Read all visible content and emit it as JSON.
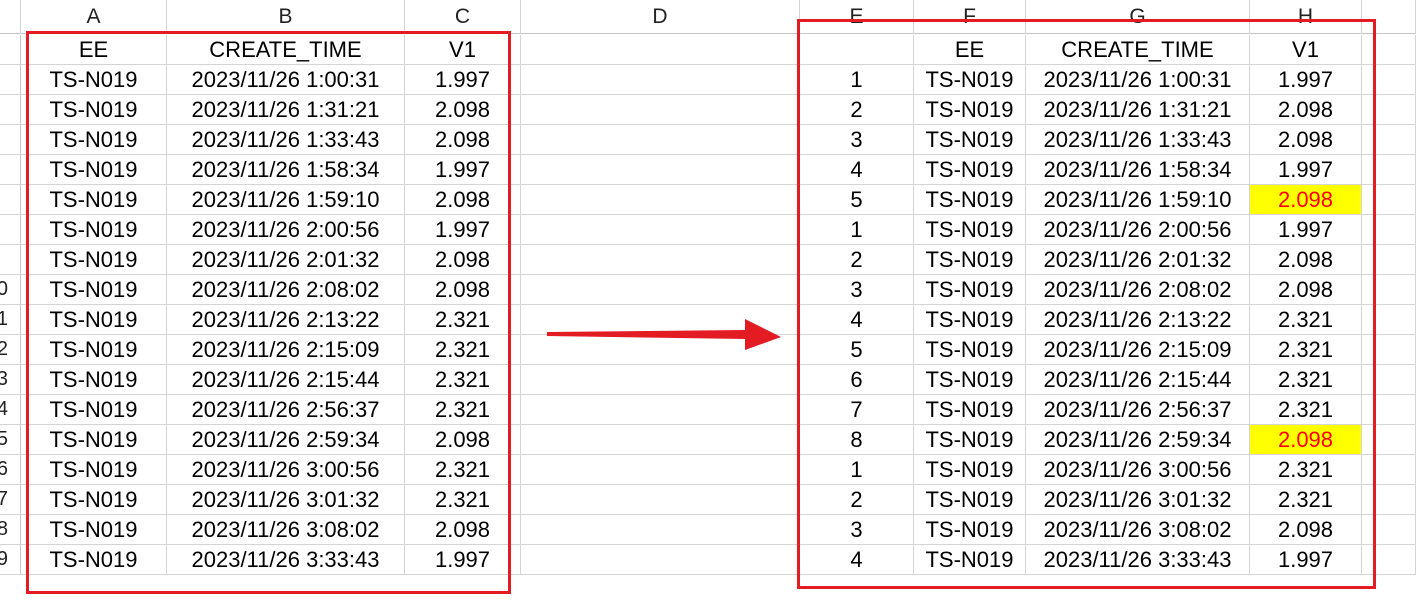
{
  "accent_color": "#e31b23",
  "highlight_fill": "#ffff00",
  "highlight_text": "#ff0000",
  "columns": [
    "A",
    "B",
    "C",
    "D",
    "E",
    "F",
    "G",
    "H"
  ],
  "row_numbers": [
    "",
    "",
    "",
    "",
    "",
    "",
    "",
    "",
    "0",
    "1",
    "2",
    "3",
    "4",
    "5",
    "6",
    "7",
    "8",
    "9"
  ],
  "left_table": {
    "headers": [
      "EE",
      "CREATE_TIME",
      "V1"
    ],
    "rows": [
      [
        "TS-N019",
        "2023/11/26 1:00:31",
        "1.997"
      ],
      [
        "TS-N019",
        "2023/11/26 1:31:21",
        "2.098"
      ],
      [
        "TS-N019",
        "2023/11/26 1:33:43",
        "2.098"
      ],
      [
        "TS-N019",
        "2023/11/26 1:58:34",
        "1.997"
      ],
      [
        "TS-N019",
        "2023/11/26 1:59:10",
        "2.098"
      ],
      [
        "TS-N019",
        "2023/11/26 2:00:56",
        "1.997"
      ],
      [
        "TS-N019",
        "2023/11/26 2:01:32",
        "2.098"
      ],
      [
        "TS-N019",
        "2023/11/26 2:08:02",
        "2.098"
      ],
      [
        "TS-N019",
        "2023/11/26 2:13:22",
        "2.321"
      ],
      [
        "TS-N019",
        "2023/11/26 2:15:09",
        "2.321"
      ],
      [
        "TS-N019",
        "2023/11/26 2:15:44",
        "2.321"
      ],
      [
        "TS-N019",
        "2023/11/26 2:56:37",
        "2.321"
      ],
      [
        "TS-N019",
        "2023/11/26 2:59:34",
        "2.098"
      ],
      [
        "TS-N019",
        "2023/11/26 3:00:56",
        "2.321"
      ],
      [
        "TS-N019",
        "2023/11/26 3:01:32",
        "2.321"
      ],
      [
        "TS-N019",
        "2023/11/26 3:08:02",
        "2.098"
      ],
      [
        "TS-N019",
        "2023/11/26 3:33:43",
        "1.997"
      ]
    ]
  },
  "right_table": {
    "headers": [
      "",
      "EE",
      "CREATE_TIME",
      "V1"
    ],
    "rows": [
      [
        "1",
        "TS-N019",
        "2023/11/26 1:00:31",
        "1.997"
      ],
      [
        "2",
        "TS-N019",
        "2023/11/26 1:31:21",
        "2.098"
      ],
      [
        "3",
        "TS-N019",
        "2023/11/26 1:33:43",
        "2.098"
      ],
      [
        "4",
        "TS-N019",
        "2023/11/26 1:58:34",
        "1.997"
      ],
      [
        "5",
        "TS-N019",
        "2023/11/26 1:59:10",
        "2.098"
      ],
      [
        "1",
        "TS-N019",
        "2023/11/26 2:00:56",
        "1.997"
      ],
      [
        "2",
        "TS-N019",
        "2023/11/26 2:01:32",
        "2.098"
      ],
      [
        "3",
        "TS-N019",
        "2023/11/26 2:08:02",
        "2.098"
      ],
      [
        "4",
        "TS-N019",
        "2023/11/26 2:13:22",
        "2.321"
      ],
      [
        "5",
        "TS-N019",
        "2023/11/26 2:15:09",
        "2.321"
      ],
      [
        "6",
        "TS-N019",
        "2023/11/26 2:15:44",
        "2.321"
      ],
      [
        "7",
        "TS-N019",
        "2023/11/26 2:56:37",
        "2.321"
      ],
      [
        "8",
        "TS-N019",
        "2023/11/26 2:59:34",
        "2.098"
      ],
      [
        "1",
        "TS-N019",
        "2023/11/26 3:00:56",
        "2.321"
      ],
      [
        "2",
        "TS-N019",
        "2023/11/26 3:01:32",
        "2.321"
      ],
      [
        "3",
        "TS-N019",
        "2023/11/26 3:08:02",
        "2.098"
      ],
      [
        "4",
        "TS-N019",
        "2023/11/26 3:33:43",
        "1.997"
      ]
    ],
    "highlighted_row_indexes": [
      4,
      12
    ]
  }
}
